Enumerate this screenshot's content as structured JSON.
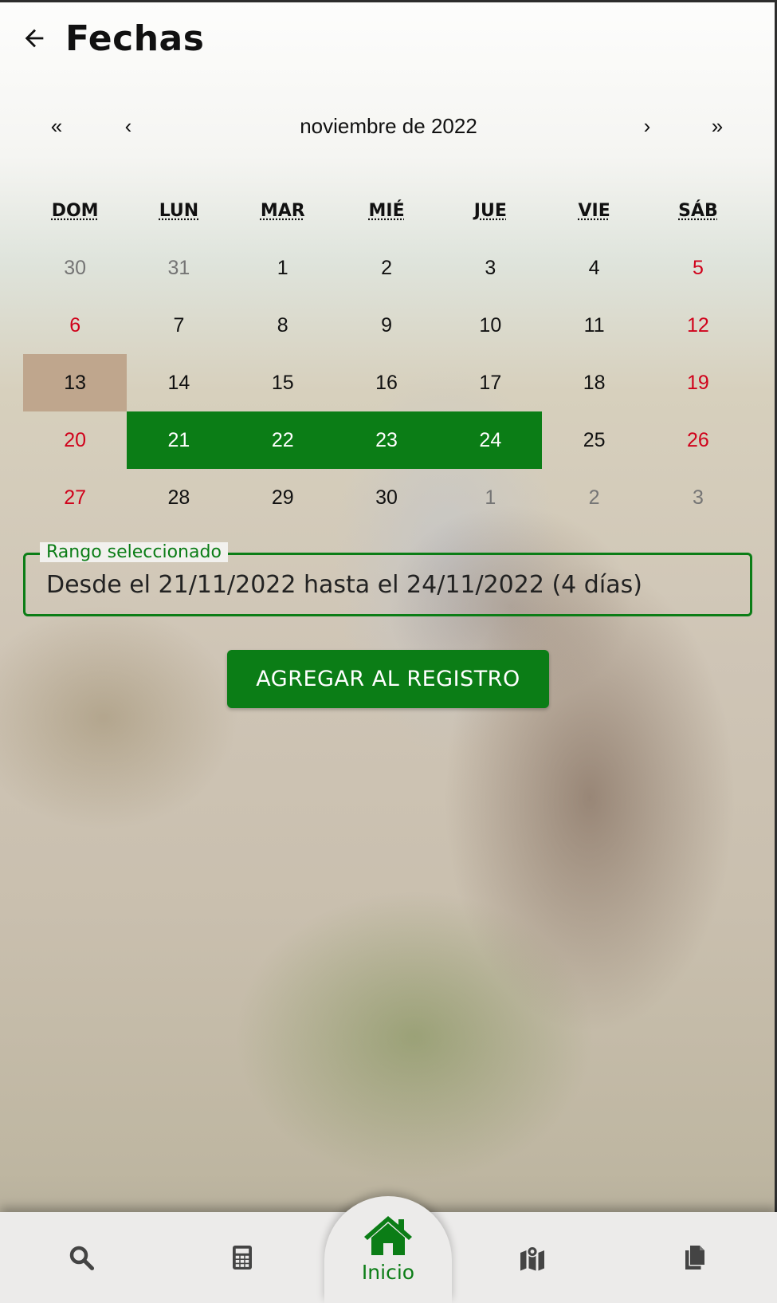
{
  "header": {
    "title": "Fechas",
    "back_icon": "arrow-left-icon"
  },
  "calendar": {
    "nav": {
      "prev_year": "«",
      "prev_month": "‹",
      "label": "noviembre de 2022",
      "next_month": "›",
      "next_year": "»"
    },
    "weekdays": [
      "DOM",
      "LUN",
      "MAR",
      "MIÉ",
      "JUE",
      "VIE",
      "SÁB"
    ],
    "weeks": [
      [
        {
          "d": "30",
          "type": "neighbor"
        },
        {
          "d": "31",
          "type": "neighbor"
        },
        {
          "d": "1",
          "type": "normal"
        },
        {
          "d": "2",
          "type": "normal"
        },
        {
          "d": "3",
          "type": "normal"
        },
        {
          "d": "4",
          "type": "normal"
        },
        {
          "d": "5",
          "type": "weekend"
        }
      ],
      [
        {
          "d": "6",
          "type": "weekend"
        },
        {
          "d": "7",
          "type": "normal"
        },
        {
          "d": "8",
          "type": "normal"
        },
        {
          "d": "9",
          "type": "normal"
        },
        {
          "d": "10",
          "type": "normal"
        },
        {
          "d": "11",
          "type": "normal"
        },
        {
          "d": "12",
          "type": "weekend"
        }
      ],
      [
        {
          "d": "13",
          "type": "today"
        },
        {
          "d": "14",
          "type": "normal"
        },
        {
          "d": "15",
          "type": "normal"
        },
        {
          "d": "16",
          "type": "normal"
        },
        {
          "d": "17",
          "type": "normal"
        },
        {
          "d": "18",
          "type": "normal"
        },
        {
          "d": "19",
          "type": "weekend"
        }
      ],
      [
        {
          "d": "20",
          "type": "weekend"
        },
        {
          "d": "21",
          "type": "in-range"
        },
        {
          "d": "22",
          "type": "in-range"
        },
        {
          "d": "23",
          "type": "in-range"
        },
        {
          "d": "24",
          "type": "in-range"
        },
        {
          "d": "25",
          "type": "normal"
        },
        {
          "d": "26",
          "type": "weekend"
        }
      ],
      [
        {
          "d": "27",
          "type": "weekend"
        },
        {
          "d": "28",
          "type": "normal"
        },
        {
          "d": "29",
          "type": "normal"
        },
        {
          "d": "30",
          "type": "normal"
        },
        {
          "d": "1",
          "type": "neighbor"
        },
        {
          "d": "2",
          "type": "neighbor"
        },
        {
          "d": "3",
          "type": "neighbor"
        }
      ]
    ]
  },
  "range": {
    "label": "Rango seleccionado",
    "value": "Desde el 21/11/2022 hasta el 24/11/2022 (4 días)"
  },
  "actions": {
    "add_label": "AGREGAR AL REGISTRO"
  },
  "bottom_nav": {
    "items": [
      {
        "icon": "search-icon"
      },
      {
        "icon": "calculator-icon"
      },
      {
        "icon": "home-icon",
        "label": "Inicio",
        "active": true
      },
      {
        "icon": "map-location-icon"
      },
      {
        "icon": "copy-documents-icon"
      }
    ]
  },
  "colors": {
    "accent": "#0b7d16",
    "weekend": "#d0021b",
    "today": "#bfa68d",
    "neighbor": "#757575"
  }
}
